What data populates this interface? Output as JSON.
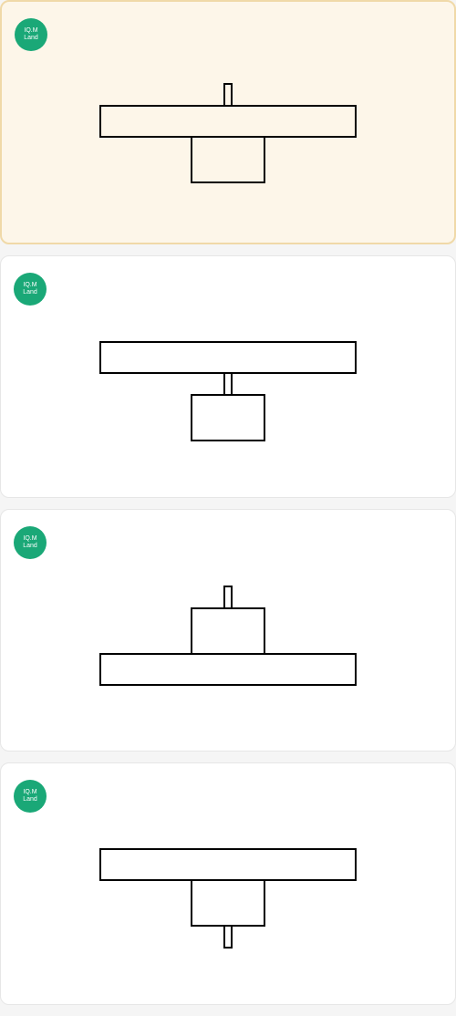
{
  "badge_label": "IQ.M Land",
  "options": [
    {
      "id": "A",
      "selected": true,
      "layout": "pin_top_rect_mid_box_bottom"
    },
    {
      "id": "B",
      "selected": false,
      "layout": "rect_top_pin_mid_box_bottom"
    },
    {
      "id": "C",
      "selected": false,
      "layout": "pin_top_box_mid_rect_bottom"
    },
    {
      "id": "D",
      "selected": false,
      "layout": "rect_top_box_mid_pin_bottom"
    }
  ]
}
